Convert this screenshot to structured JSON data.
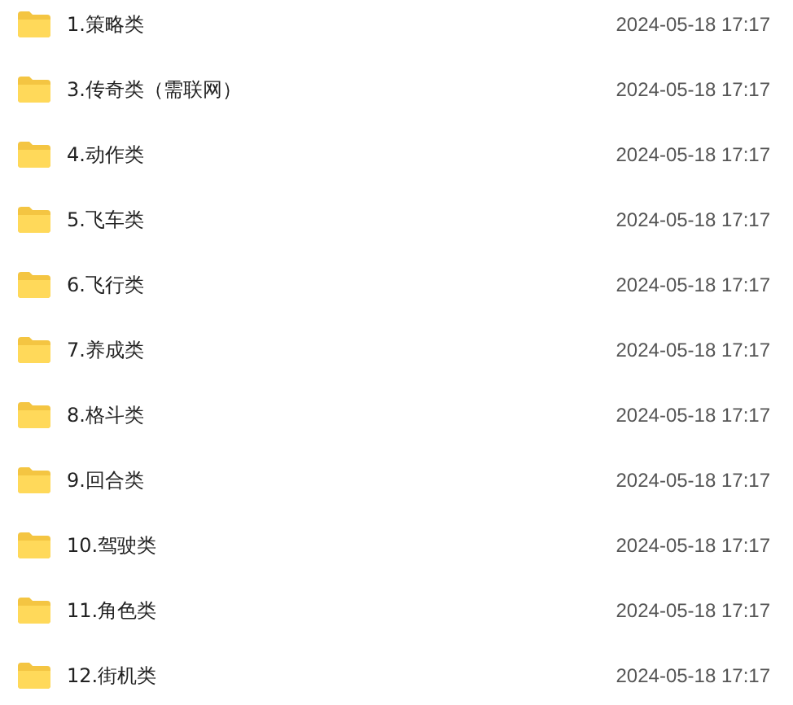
{
  "files": [
    {
      "name": "1.策略类",
      "modified": "2024-05-18 17:17"
    },
    {
      "name": "3.传奇类（需联网）",
      "modified": "2024-05-18 17:17"
    },
    {
      "name": "4.动作类",
      "modified": "2024-05-18 17:17"
    },
    {
      "name": "5.飞车类",
      "modified": "2024-05-18 17:17"
    },
    {
      "name": "6.飞行类",
      "modified": "2024-05-18 17:17"
    },
    {
      "name": "7.养成类",
      "modified": "2024-05-18 17:17"
    },
    {
      "name": "8.格斗类",
      "modified": "2024-05-18 17:17"
    },
    {
      "name": "9.回合类",
      "modified": "2024-05-18 17:17"
    },
    {
      "name": "10.驾驶类",
      "modified": "2024-05-18 17:17"
    },
    {
      "name": "11.角色类",
      "modified": "2024-05-18 17:17"
    },
    {
      "name": "12.街机类",
      "modified": "2024-05-18 17:17"
    }
  ]
}
